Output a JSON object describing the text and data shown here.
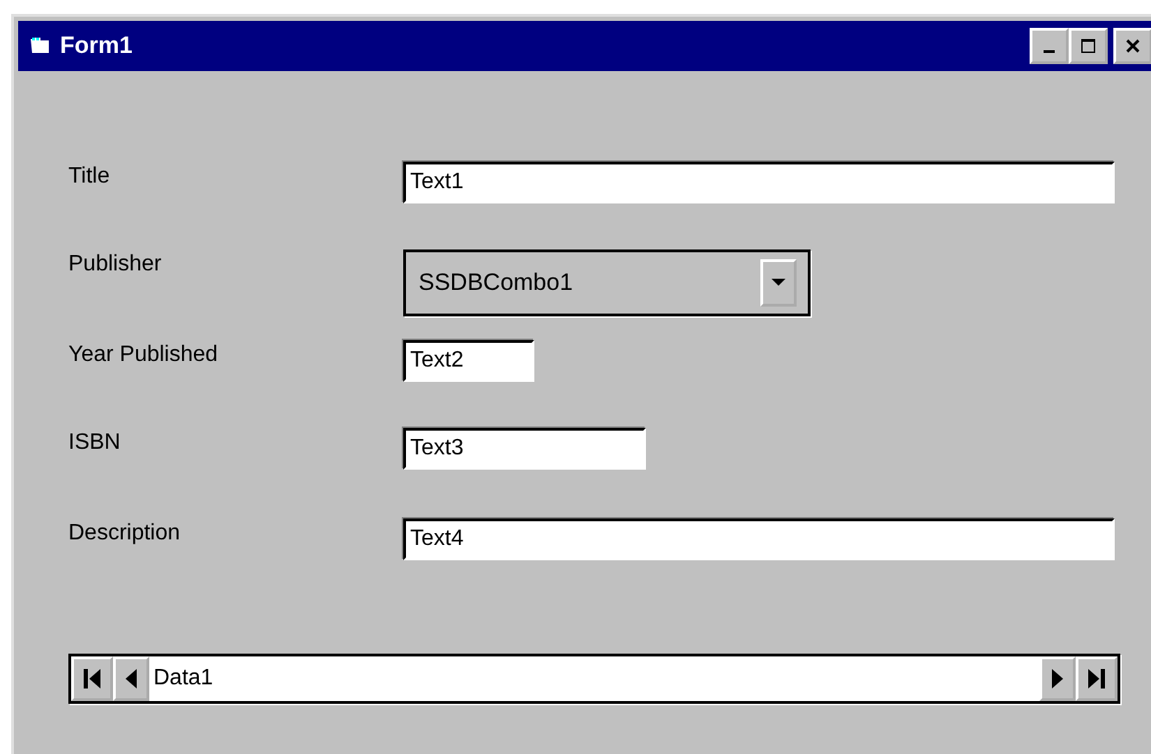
{
  "window": {
    "title": "Form1"
  },
  "fields": [
    {
      "label": "Title",
      "kind": "text",
      "value": "Text1"
    },
    {
      "label": "Publisher",
      "kind": "combo",
      "value": "SSDBCombo1"
    },
    {
      "label": "Year Published",
      "kind": "text",
      "value": "Text2"
    },
    {
      "label": "ISBN",
      "kind": "text",
      "value": "Text3"
    },
    {
      "label": "Description",
      "kind": "text",
      "value": "Text4"
    }
  ],
  "data_control": {
    "caption": "Data1"
  }
}
